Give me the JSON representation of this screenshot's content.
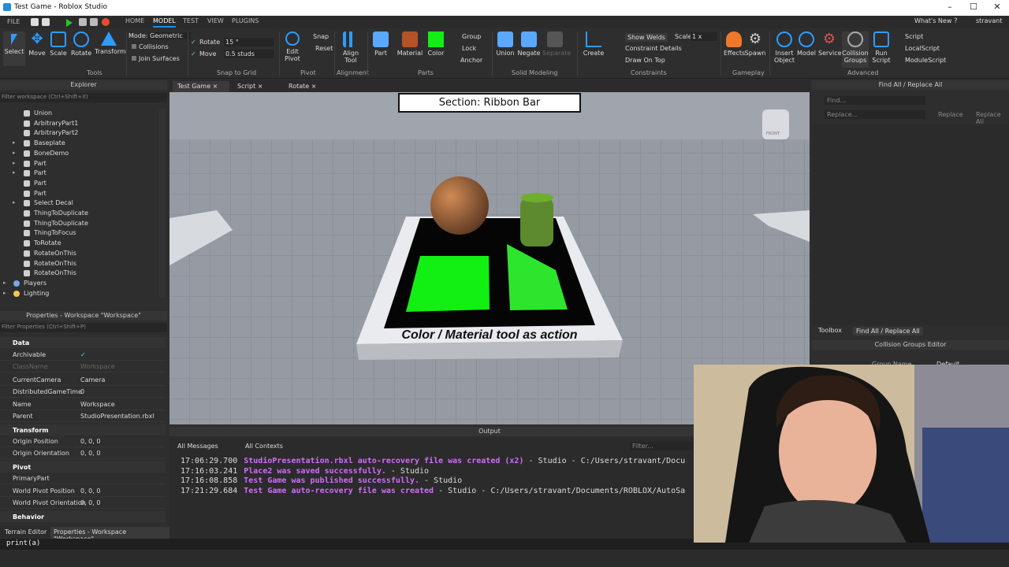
{
  "window": {
    "title": "Test Game - Roblox Studio",
    "minimize": "–",
    "maximize": "☐",
    "close": "✕"
  },
  "menubar": {
    "file": "FILE",
    "tabs": [
      "HOME",
      "MODEL",
      "TEST",
      "VIEW",
      "PLUGINS"
    ],
    "whats_new": "What's New",
    "user": "stravant"
  },
  "ribbon": {
    "tools": [
      "Select",
      "Move",
      "Scale",
      "Rotate",
      "Transform"
    ],
    "tools_group": "Tools",
    "mode_label": "Mode:",
    "mode_value": "Geometric",
    "collisions": "Collisions",
    "join_surfaces": "Join Surfaces",
    "rotate_label": "Rotate",
    "rotate_value": "15 °",
    "move_label": "Move",
    "move_value": "0.5 studs",
    "snap_group": "Snap to Grid",
    "edit_pivot": "Edit\nPivot",
    "snap": "Snap",
    "reset": "Reset",
    "pivot_group": "Pivot",
    "align_tool": "Align\nTool",
    "alignment_group": "Alignment",
    "part": "Part",
    "material": "Material",
    "color": "Color",
    "group": "Group",
    "lock": "Lock",
    "anchor": "Anchor",
    "parts_group": "Parts",
    "union": "Union",
    "negate": "Negate",
    "separate": "Separate",
    "solid_group": "Solid Modeling",
    "create": "Create",
    "show_welds": "Show Welds",
    "constraint_details": "Constraint Details",
    "draw_on_top": "Draw On Top",
    "scale_label": "Scale",
    "scale_value": "1 x",
    "constraints_group": "Constraints",
    "effects": "Effects",
    "spawn": "Spawn",
    "gameplay_group": "Gameplay",
    "insert_object": "Insert\nObject",
    "model": "Model",
    "service": "Service",
    "collision_groups": "Collision\nGroups",
    "run_script": "Run\nScript",
    "script": "Script",
    "local_script": "LocalScript",
    "module_script": "ModuleScript",
    "advanced_group": "Advanced"
  },
  "explorer": {
    "title": "Explorer",
    "filter": "Filter workspace (Ctrl+Shift+X)",
    "items": [
      {
        "label": "Union",
        "expandable": false
      },
      {
        "label": "ArbitraryPart1",
        "expandable": false
      },
      {
        "label": "ArbitraryPart2",
        "expandable": false
      },
      {
        "label": "Baseplate",
        "expandable": true
      },
      {
        "label": "BoneDemo",
        "expandable": true
      },
      {
        "label": "Part",
        "expandable": true
      },
      {
        "label": "Part",
        "expandable": true
      },
      {
        "label": "Part",
        "expandable": false
      },
      {
        "label": "Part",
        "expandable": false
      },
      {
        "label": "Select Decal",
        "expandable": true
      },
      {
        "label": "ThingToDuplicate",
        "expandable": false
      },
      {
        "label": "ThingToDuplicate",
        "expandable": false
      },
      {
        "label": "ThingToFocus",
        "expandable": false
      },
      {
        "label": "ToRotate",
        "expandable": false
      },
      {
        "label": "RotateOnThis",
        "expandable": false
      },
      {
        "label": "RotateOnThis",
        "expandable": false
      },
      {
        "label": "RotateOnThis",
        "expandable": false
      }
    ],
    "services": [
      "Players",
      "Lighting"
    ]
  },
  "properties": {
    "title": "Properties - Workspace \"Workspace\"",
    "filter": "Filter Properties (Ctrl+Shift+P)",
    "sections": {
      "data": "Data",
      "transform": "Transform",
      "pivot": "Pivot",
      "behavior": "Behavior"
    },
    "rows": [
      {
        "k": "Archivable",
        "v": "✓"
      },
      {
        "k": "ClassName",
        "v": "Workspace"
      },
      {
        "k": "CurrentCamera",
        "v": "Camera"
      },
      {
        "k": "DistributedGameTime",
        "v": "0"
      },
      {
        "k": "Name",
        "v": "Workspace"
      },
      {
        "k": "Parent",
        "v": "StudioPresentation.rbxl"
      },
      {
        "k": "Origin Position",
        "v": "0, 0, 0"
      },
      {
        "k": "Origin Orientation",
        "v": "0, 0, 0"
      },
      {
        "k": "PrimaryPart",
        "v": ""
      },
      {
        "k": "World Pivot Position",
        "v": "0, 0, 0"
      },
      {
        "k": "World Pivot Orientation",
        "v": "0, 0, 0"
      }
    ]
  },
  "doc_tabs": [
    "Test Game",
    "Script",
    "Rotate"
  ],
  "viewport": {
    "section_banner": "Section: Ribbon Bar",
    "platform_text": "Color / Material tool as action",
    "viewcube": "FRONT"
  },
  "output": {
    "title": "Output",
    "messages_filter": "All Messages",
    "contexts_filter": "All Contexts",
    "filter_placeholder": "Filter...",
    "lines": [
      {
        "time": "17:06:29.700",
        "msg": "StudioPresentation.rbxl auto-recovery file was created (x2)",
        "src": "  -  Studio - C:/Users/stravant/Docu"
      },
      {
        "time": "17:16:03.241",
        "msg": "Place2 was saved successfully.",
        "src": "  -  Studio"
      },
      {
        "time": "17:16:08.858",
        "msg": "Test Game was published successfully.",
        "src": "  -  Studio"
      },
      {
        "time": "17:21:29.684",
        "msg": "Test Game auto-recovery file was created",
        "src": "  -  Studio - C:/Users/stravant/Documents/ROBLOX/AutoSa"
      }
    ]
  },
  "find_panel": {
    "title": "Find All / Replace All",
    "find_placeholder": "Find...",
    "replace_placeholder": "Replace...",
    "replace": "Replace",
    "replace_all": "Replace All",
    "tabs": [
      "Toolbox",
      "Find All / Replace All"
    ]
  },
  "collision_editor": {
    "title": "Collision Groups Editor",
    "group_name": "Group Name",
    "default": "Default"
  },
  "bottom_tabs": [
    "Terrain Editor",
    "Properties - Workspace \"Workspace\""
  ],
  "command_bar": {
    "value": "print(a)"
  },
  "colors": {
    "accent": "#1f8ce6",
    "magenta": "#d36bff",
    "green": "#12ef12",
    "panel": "#2e2e2e"
  }
}
